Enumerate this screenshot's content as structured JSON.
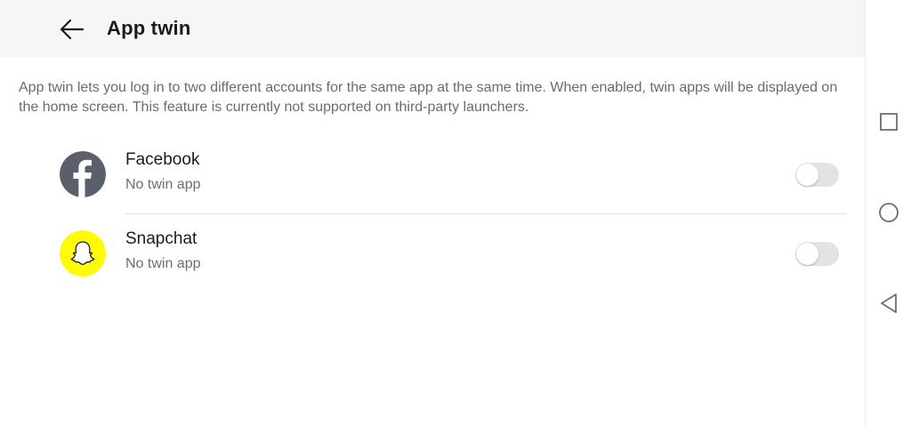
{
  "header": {
    "title": "App twin",
    "back_icon": "arrow-left-icon"
  },
  "description": "App twin lets you log in to two different accounts for the same app at the same time. When enabled, twin apps will be displayed on the home screen. This feature is currently not supported on third-party launchers.",
  "apps": [
    {
      "name": "Facebook",
      "status": "No twin app",
      "icon": "facebook-icon",
      "icon_bg": "#5a5f6b",
      "toggle_on": false
    },
    {
      "name": "Snapchat",
      "status": "No twin app",
      "icon": "snapchat-icon",
      "icon_bg": "#fffc00",
      "toggle_on": false
    }
  ],
  "navbar": {
    "buttons": [
      "recent-apps-icon",
      "home-icon",
      "back-icon"
    ]
  },
  "colors": {
    "header_bg": "#f6f6f6",
    "toggle_off": "#e3e3e3",
    "snapchat_yellow": "#fffc00",
    "facebook_grey": "#5a5f6b"
  }
}
